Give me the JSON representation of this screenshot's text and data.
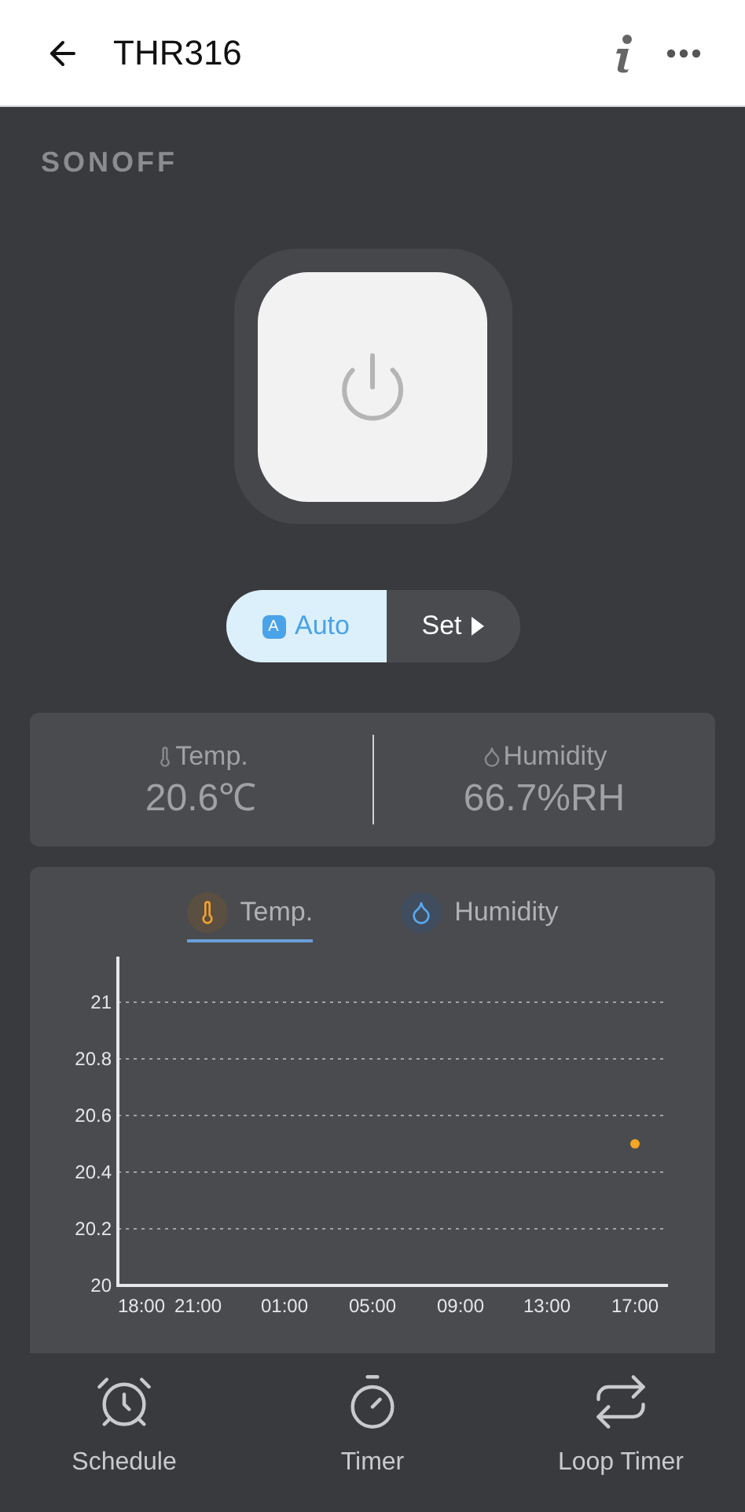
{
  "header": {
    "title": "THR316"
  },
  "brand": {
    "logo": "SONOFF"
  },
  "power": {
    "on": false
  },
  "modes": [
    {
      "kind": "auto",
      "label": "Auto",
      "badge": "A",
      "selected": true
    },
    {
      "kind": "set",
      "label": "Set",
      "selected": false
    }
  ],
  "readings": [
    {
      "kind": "temp",
      "label": "Temp.",
      "value": "20.6℃"
    },
    {
      "kind": "humidity",
      "label": "Humidity",
      "value": "66.7%RH"
    }
  ],
  "chart_tabs": [
    {
      "kind": "temp",
      "label": "Temp.",
      "selected": true
    },
    {
      "kind": "humidity",
      "label": "Humidity",
      "selected": false
    }
  ],
  "chart_data": {
    "type": "scatter",
    "grid": true,
    "ylim": [
      20,
      21
    ],
    "categories": [
      "18:00",
      "21:00",
      "01:00",
      "05:00",
      "09:00",
      "13:00",
      "17:00"
    ],
    "yticks": [
      {
        "value": 20,
        "label": "20"
      },
      {
        "value": 20.2,
        "label": "20.2"
      },
      {
        "value": 20.4,
        "label": "20.4"
      },
      {
        "value": 20.6,
        "label": "20.6"
      },
      {
        "value": 20.8,
        "label": "20.8"
      },
      {
        "value": 21,
        "label": "21"
      }
    ],
    "series": [
      {
        "color": "#f5a623",
        "values": [
          null,
          null,
          null,
          null,
          null,
          null,
          20.5
        ]
      }
    ]
  },
  "nav": [
    {
      "kind": "schedule",
      "label": "Schedule"
    },
    {
      "kind": "timer",
      "label": "Timer"
    },
    {
      "kind": "loop",
      "label": "Loop Timer"
    }
  ]
}
